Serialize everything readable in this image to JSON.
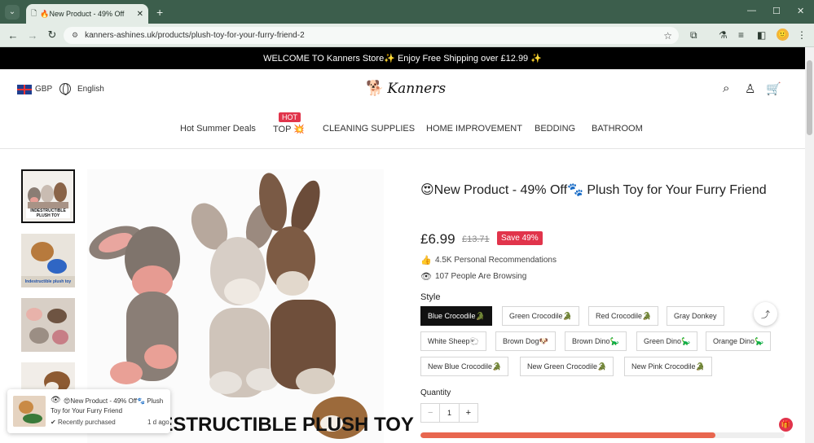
{
  "browser": {
    "tab_title": "🔥New Product - 49% Off",
    "url": "kanners-ashines.uk/products/plush-toy-for-your-furry-friend-2"
  },
  "promo_bar": {
    "text": "WELCOME TO Kanners Store✨ Enjoy Free Shipping over £12.99 ✨"
  },
  "header": {
    "currency": "GBP",
    "language": "English",
    "logo_text": "Kanners",
    "nav": [
      {
        "label": "Hot Summer Deals"
      },
      {
        "label": "TOP 💥",
        "badge": "HOT"
      },
      {
        "label": "CLEANING SUPPLIES"
      },
      {
        "label": "HOME IMPROVEMENT"
      },
      {
        "label": "BEDDING"
      },
      {
        "label": "BATHROOM"
      }
    ]
  },
  "gallery": {
    "thumb_labels": [
      "INDESTRUCTIBLE PLUSH TOY",
      "Indestructible plush toy"
    ],
    "main_caption": "INDESTRUCTIBLE PLUSH TOY"
  },
  "product": {
    "title": "😍New Product - 49% Off🐾 Plush Toy for Your Furry Friend",
    "price": "£6.99",
    "compare_price": "£13.71",
    "save_badge": "Save 49%",
    "recommendations": "4.5K Personal Recommendations",
    "browsing": "107 People Are Browsing",
    "style_label": "Style",
    "styles": [
      "Blue Crocodile🐊",
      "Green Crocodile🐊",
      "Red Crocodile🐊",
      "Gray Donkey",
      "White Sheep🐑",
      "Brown Dog🐶",
      "Brown Dino🦕",
      "Green Dino🦕",
      "Orange Dino🦕",
      "New Blue Crocodile🐊",
      "New Green Crocodile🐊",
      "New Pink Crocodile🐊"
    ],
    "selected_style": "Blue Crocodile🐊",
    "quantity_label": "Quantity",
    "quantity_minus": "−",
    "quantity": "1",
    "quantity_plus": "+",
    "progress_fraction": 0.81
  },
  "popup": {
    "text": "😍New Product - 49% Off🐾 Plush Toy for Your Furry Friend",
    "recent": "Recently purchased",
    "ago": "1 d ago"
  },
  "colors": {
    "accent": "#e1344b",
    "progress": "#e8664f",
    "chrome": "#3c5e4c"
  }
}
